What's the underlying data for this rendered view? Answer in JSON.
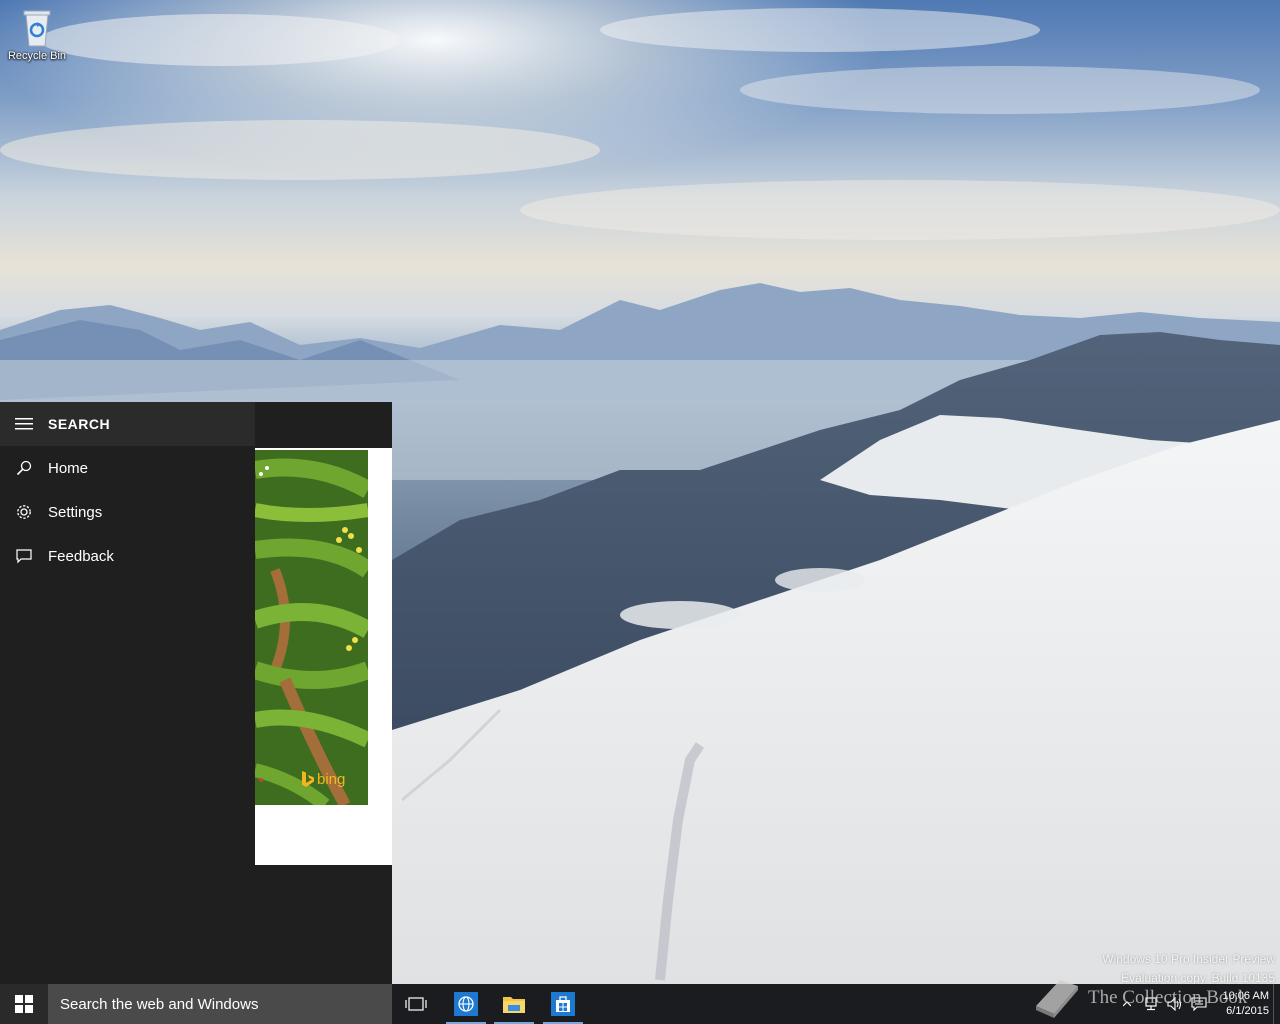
{
  "desktop": {
    "icons": [
      {
        "label": "Recycle Bin",
        "icon": "recycle-bin-icon"
      }
    ]
  },
  "search_panel": {
    "title": "SEARCH",
    "menu_icon": "hamburger-menu-icon",
    "items": [
      {
        "label": "Home",
        "icon": "search-icon"
      },
      {
        "label": "Settings",
        "icon": "gear-icon"
      },
      {
        "label": "Feedback",
        "icon": "feedback-icon"
      }
    ],
    "card_brand": "bing"
  },
  "taskbar": {
    "start_icon": "windows-logo-icon",
    "search_placeholder": "Search the web and Windows",
    "buttons": [
      {
        "name": "task-view",
        "icon": "task-view-icon"
      },
      {
        "name": "browser",
        "icon": "globe-icon"
      },
      {
        "name": "file-explorer",
        "icon": "folder-icon"
      },
      {
        "name": "store",
        "icon": "store-icon"
      }
    ],
    "tray": {
      "time": "10:06 AM",
      "date": "6/1/2015"
    }
  },
  "watermark": {
    "line1": "Windows 10 Pro Insider Preview",
    "line2": "Evaluation copy. Build 10135",
    "logo_text": "The Collection Book"
  },
  "colors": {
    "panel_bg": "#1f1f1f",
    "taskbar_bg": "#1b1c1f",
    "search_bg": "#4a4a4a",
    "bing_yellow": "#f3b61f"
  }
}
